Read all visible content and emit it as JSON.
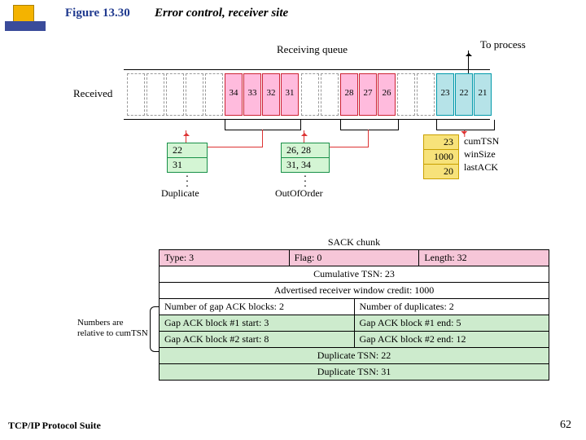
{
  "figure": {
    "number": "Figure 13.30",
    "title": "Error control, receiver site"
  },
  "footer": {
    "left": "TCP/IP Protocol Suite",
    "page": "62"
  },
  "labels": {
    "receiving_queue": "Receiving queue",
    "to_process": "To process",
    "received": "Received",
    "duplicate": "Duplicate",
    "out_of_order": "OutOfOrder",
    "cumtsn": "cumTSN",
    "winsize": "winSize",
    "lastack": "lastACK"
  },
  "queue": {
    "block1": [
      "34",
      "33",
      "32",
      "31"
    ],
    "block2": [
      "28",
      "27",
      "26"
    ],
    "block3": [
      "23",
      "22",
      "21"
    ]
  },
  "duplicate_box": {
    "l1": "22",
    "l2": "31"
  },
  "ooo_box": {
    "l1": "26, 28",
    "l2": "31, 34"
  },
  "state": {
    "cumtsn": "23",
    "winsize": "1000",
    "lastack": "20"
  },
  "sack": {
    "title": "SACK chunk",
    "header": {
      "type": "Type: 3",
      "flag": "Flag: 0",
      "length": "Length: 32"
    },
    "cum": "Cumulative TSN: 23",
    "credit": "Advertised receiver window credit: 1000",
    "counts": {
      "gap": "Number of gap ACK blocks: 2",
      "dup": "Number of duplicates: 2"
    },
    "gaps": [
      {
        "s": "Gap ACK block #1 start: 3",
        "e": "Gap ACK block #1 end: 5"
      },
      {
        "s": "Gap ACK block #2 start: 8",
        "e": "Gap ACK block #2 end: 12"
      }
    ],
    "dups": [
      "Duplicate TSN: 22",
      "Duplicate TSN: 31"
    ],
    "note": "Numbers are relative to cumTSN"
  }
}
